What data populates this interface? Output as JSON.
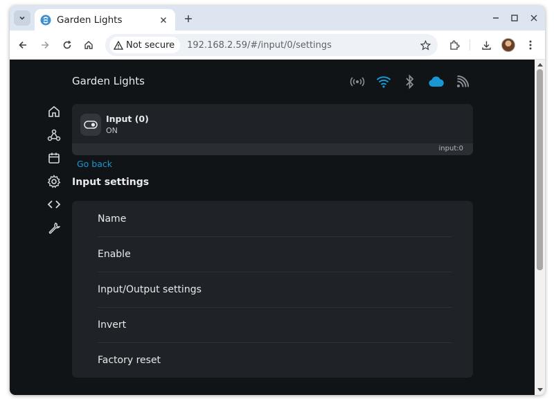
{
  "browser": {
    "tab_title": "Garden Lights",
    "security_label": "Not secure",
    "url": "192.168.2.59/#/input/0/settings",
    "accent": "#1a96d4"
  },
  "header": {
    "app_title": "Garden Lights",
    "status_icons": [
      "wifi-ap-icon",
      "wifi-icon",
      "bluetooth-icon",
      "cloud-icon",
      "rss-icon"
    ]
  },
  "sidenav": {
    "items": [
      "home-icon",
      "webhooks-icon",
      "calendar-icon",
      "settings-gear-icon",
      "code-icon",
      "wrench-icon"
    ]
  },
  "input_card": {
    "name": "Input (0)",
    "state": "ON",
    "id": "input:0"
  },
  "go_back": "Go back",
  "section_title": "Input settings",
  "settings_items": [
    {
      "label": "Name"
    },
    {
      "label": "Enable"
    },
    {
      "label": "Input/Output settings"
    },
    {
      "label": "Invert"
    },
    {
      "label": "Factory reset"
    }
  ]
}
